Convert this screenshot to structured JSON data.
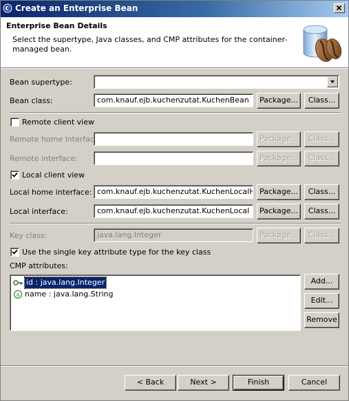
{
  "window": {
    "title": "Create an Enterprise Bean"
  },
  "banner": {
    "title": "Enterprise Bean Details",
    "description": "Select the supertype, Java classes, and CMP attributes for the container-managed bean."
  },
  "form": {
    "bean_supertype_label": "Bean supertype:",
    "bean_supertype_value": "",
    "bean_class_label": "Bean class:",
    "bean_class_value": "com.knauf.ejb.kuchenzutat.KuchenBean",
    "remote_client_view_label": "Remote client view",
    "remote_client_view_checked": false,
    "remote_home_label": "Remote home interface:",
    "remote_home_value": "",
    "remote_interface_label": "Remote interface:",
    "remote_interface_value": "",
    "local_client_view_label": "Local client view",
    "local_client_view_checked": true,
    "local_home_label": "Local home interface:",
    "local_home_value": "com.knauf.ejb.kuchenzutat.KuchenLocalHome",
    "local_interface_label": "Local interface:",
    "local_interface_value": "com.knauf.ejb.kuchenzutat.KuchenLocal",
    "key_class_label": "Key class:",
    "key_class_value": "java.lang.Integer",
    "single_key_label": "Use the single key attribute type for the key class",
    "single_key_checked": true,
    "cmp_attributes_label": "CMP attributes:"
  },
  "buttons": {
    "package": "Package...",
    "class": "Class...",
    "add": "Add...",
    "edit": "Edit...",
    "remove": "Remove",
    "back": "< Back",
    "next": "Next >",
    "finish": "Finish",
    "cancel": "Cancel"
  },
  "cmp_attributes": [
    {
      "text": "id : java.lang.Integer",
      "icon": "key-attribute-icon",
      "selected": true
    },
    {
      "text": "name : java.lang.String",
      "icon": "attribute-icon",
      "selected": false
    }
  ],
  "colors": {
    "title_bar_start": "#0a246a",
    "title_bar_end": "#a6caf0",
    "selection": "#0a246a",
    "dialog_face": "#d4d0c8"
  }
}
